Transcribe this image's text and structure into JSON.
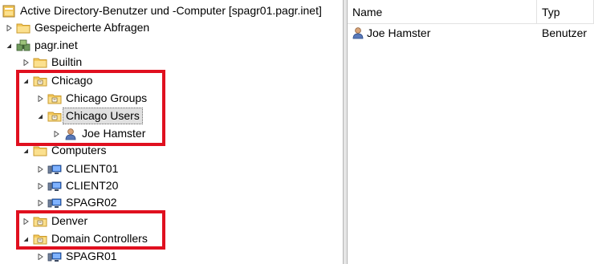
{
  "colors": {
    "highlight_box": "#e0101f",
    "folder": "#f4c85a",
    "selection_bg": "#e0e0e0"
  },
  "tree": {
    "root_label": "Active Directory-Benutzer und -Computer [spagr01.pagr.inet]",
    "saved_queries": "Gespeicherte Abfragen",
    "domain": "pagr.inet",
    "builtin": "Builtin",
    "chicago": "Chicago",
    "chicago_groups": "Chicago Groups",
    "chicago_users": "Chicago Users",
    "joe_hamster": "Joe Hamster",
    "computers": "Computers",
    "client01": "CLIENT01",
    "client20": "CLIENT20",
    "spagr02": "SPAGR02",
    "denver": "Denver",
    "domain_controllers": "Domain Controllers",
    "spagr01": "SPAGR01"
  },
  "list": {
    "columns": [
      "Name",
      "Typ"
    ],
    "rows": [
      {
        "name": "Joe Hamster",
        "type": "Benutzer",
        "icon": "user-icon"
      }
    ]
  }
}
